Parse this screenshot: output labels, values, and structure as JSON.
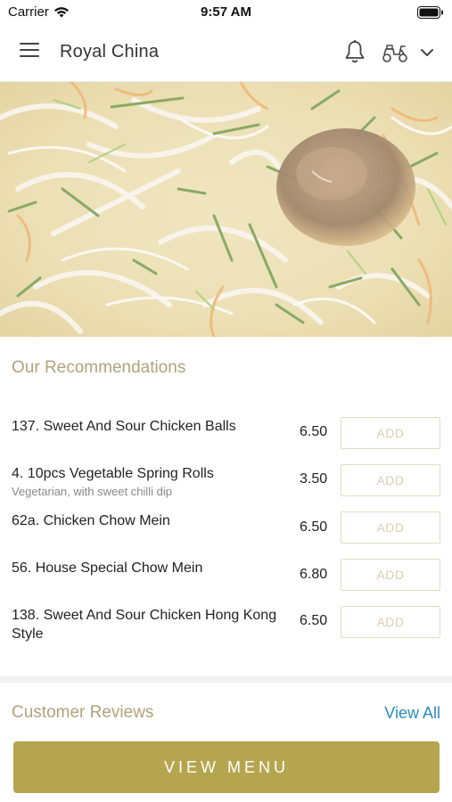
{
  "status_bar": {
    "carrier": "Carrier",
    "time": "9:57 AM"
  },
  "header": {
    "title": "Royal China",
    "icons": [
      "menu-icon",
      "bell-icon",
      "scooter-icon",
      "chevron-down-icon"
    ]
  },
  "recommendations": {
    "title": "Our Recommendations",
    "add_label": "ADD",
    "items": [
      {
        "name": "137. Sweet And Sour Chicken Balls",
        "description": "",
        "price": "6.50"
      },
      {
        "name": "4. 10pcs Vegetable Spring Rolls",
        "description": "Vegetarian, with sweet chilli dip",
        "price": "3.50"
      },
      {
        "name": "62a. Chicken Chow Mein",
        "description": "",
        "price": "6.50"
      },
      {
        "name": "56. House Special Chow Mein",
        "description": "",
        "price": "6.80"
      },
      {
        "name": "138. Sweet And Sour Chicken Hong Kong Style",
        "description": "",
        "price": "6.50"
      }
    ]
  },
  "reviews": {
    "title": "Customer Reviews",
    "view_all": "View All"
  },
  "footer": {
    "view_menu": "VIEW MENU"
  },
  "colors": {
    "accent_gold": "#b5a54f",
    "section_title": "#b1a37a",
    "link_blue": "#2a8bbf"
  }
}
